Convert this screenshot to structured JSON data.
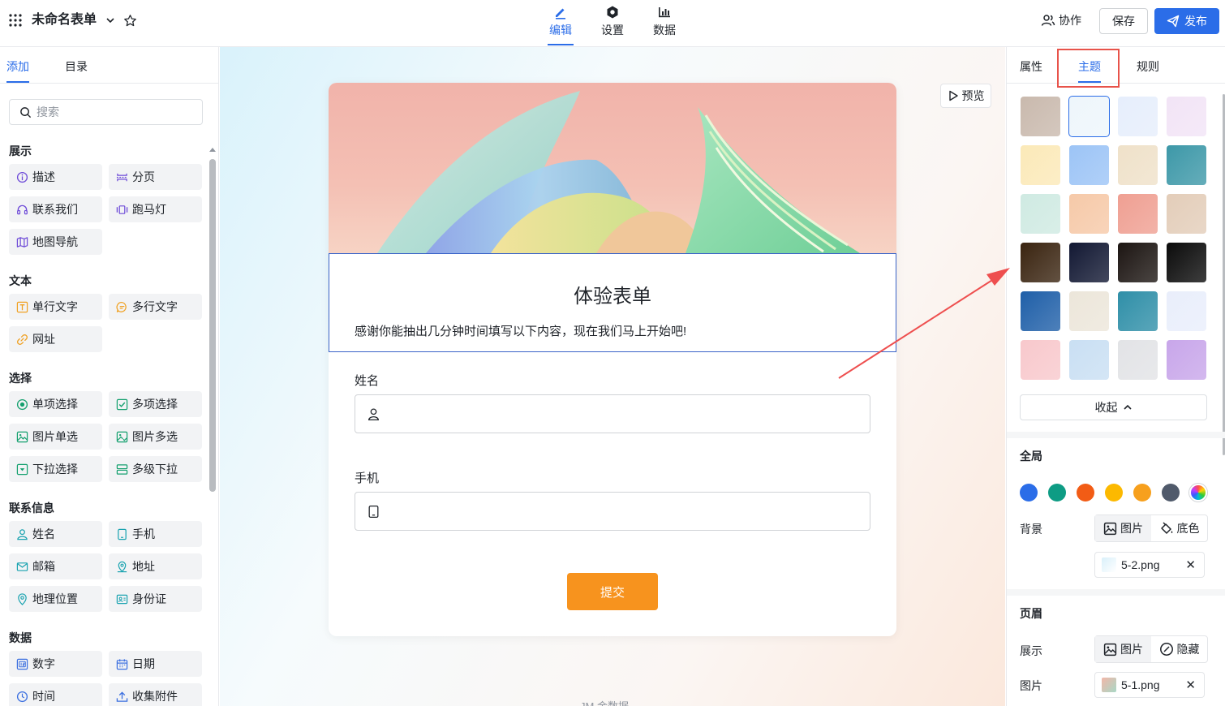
{
  "header": {
    "title": "未命名表单",
    "nav": [
      {
        "label": "编辑",
        "active": true
      },
      {
        "label": "设置",
        "active": false
      },
      {
        "label": "数据",
        "active": false
      }
    ],
    "collab_label": "协作",
    "save_label": "保存",
    "publish_label": "发布"
  },
  "left": {
    "tabs": [
      {
        "label": "添加",
        "active": true
      },
      {
        "label": "目录",
        "active": false
      }
    ],
    "search_placeholder": "搜索",
    "sections": [
      {
        "title": "展示",
        "items": [
          "描述",
          "分页",
          "联系我们",
          "跑马灯",
          "地图导航"
        ]
      },
      {
        "title": "文本",
        "items": [
          "单行文字",
          "多行文字",
          "网址"
        ]
      },
      {
        "title": "选择",
        "items": [
          "单项选择",
          "多项选择",
          "图片单选",
          "图片多选",
          "下拉选择",
          "多级下拉"
        ]
      },
      {
        "title": "联系信息",
        "items": [
          "姓名",
          "手机",
          "邮箱",
          "地址",
          "地理位置",
          "身份证"
        ]
      },
      {
        "title": "数据",
        "items": [
          "数字",
          "日期",
          "时间",
          "收集附件"
        ]
      }
    ]
  },
  "canvas": {
    "preview_label": "预览",
    "form_title": "体验表单",
    "form_desc": "感谢你能抽出几分钟时间填写以下内容，现在我们马上开始吧!",
    "fields": [
      {
        "label": "姓名",
        "icon": "user-icon"
      },
      {
        "label": "手机",
        "icon": "phone-icon"
      }
    ],
    "submit_label": "提交",
    "footer": "JM 金数据"
  },
  "right": {
    "tabs": [
      {
        "label": "属性",
        "active": false
      },
      {
        "label": "主题",
        "active": true
      },
      {
        "label": "规则",
        "active": false
      }
    ],
    "theme_swatches": [
      "#c9b9ad",
      "#eef6fb",
      "#e6eefc",
      "#f2e4f6",
      "#fbe9b8",
      "#9cc4f6",
      "#efe1c9",
      "#3d98a8",
      "#cfeae2",
      "#f6c9a8",
      "#ef9f92",
      "#e3cdb9",
      "#3a2410",
      "#121833",
      "#1c1512",
      "#0b0b0b",
      "#1f5fa8",
      "#ece6da",
      "#2f8fa8",
      "#e9eefb",
      "#f8c8cc",
      "#c9dff3",
      "#e2e3e6",
      "#c8a6ea"
    ],
    "selected_swatch": 1,
    "collapse_label": "收起",
    "global_title": "全局",
    "global_colors": [
      "#2b6de8",
      "#0e9c84",
      "#f25c15",
      "#fcb900",
      "#f7a01d",
      "#505a6b"
    ],
    "bg_label": "背景",
    "bg_options": [
      "图片",
      "底色"
    ],
    "bg_file": "5-2.png",
    "header_title": "页眉",
    "display_label": "展示",
    "display_options": [
      "图片",
      "隐藏"
    ],
    "image_label": "图片",
    "header_file": "5-1.png"
  }
}
